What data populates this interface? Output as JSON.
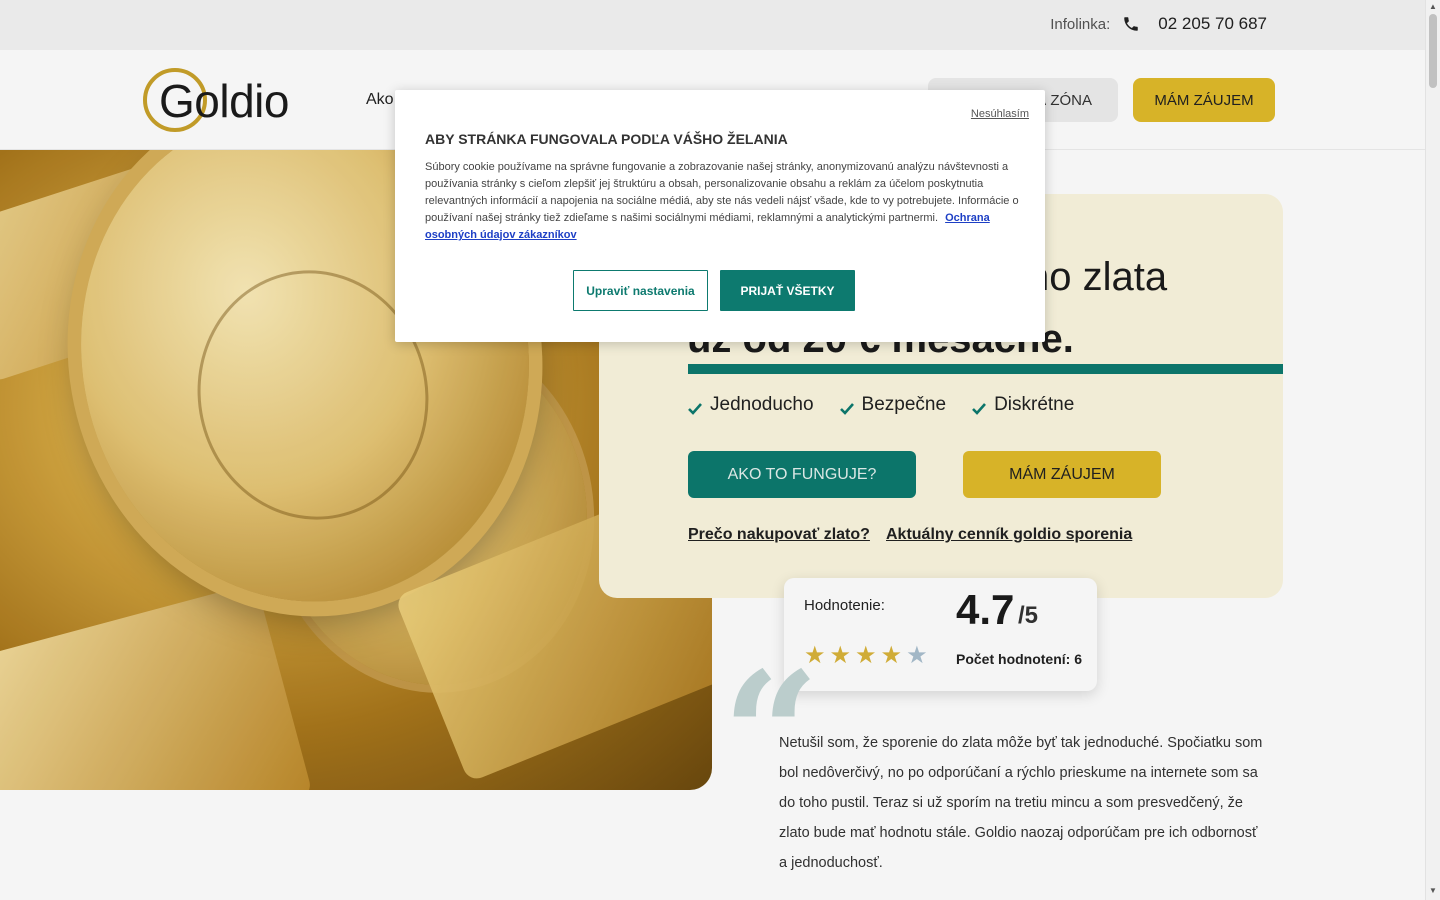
{
  "topbar": {
    "infolinka_label": "Infolinka:",
    "phone_number": "02 205 70 687"
  },
  "header": {
    "logo_text": "Goldio",
    "nav_partial": "Ako",
    "zona_partial": "Á ZÓNA",
    "cta_label": "MÁM ZÁUJEM"
  },
  "hero": {
    "title_line1": "no zlata",
    "title_line2": "už od 20 € mesačne.",
    "features": [
      {
        "label": "Jednoducho"
      },
      {
        "label": "Bezpečne"
      },
      {
        "label": "Diskrétne"
      }
    ],
    "how_button": "AKO TO FUNGUJE?",
    "interest_button": "MÁM ZÁUJEM",
    "link_why": "Prečo nakupovať zlato?",
    "link_pricelist": "Aktuálny cenník goldio sporenia"
  },
  "rating": {
    "label": "Hodnotenie:",
    "value": "4.7",
    "max": "/5",
    "stars_filled": 4,
    "stars_total": 5,
    "count_label": "Počet hodnotení: 6"
  },
  "testimonial": {
    "quote_mark": "“",
    "text": "Netušil som, že sporenie do zlata môže byť tak jednoduché. Spočiatku som bol nedôverčivý, no po odporúčaní a rýchlo prieskume na internete som sa do toho pustil. Teraz si už sporím na tretiu mincu a som presvedčený, že zlato bude mať hodnotu stále. Goldio naozaj odporúčam pre ich odbornosť a jednoduchosť."
  },
  "cookie_dialog": {
    "decline_label": "Nesúhlasím",
    "title": "ABY STRÁNKA FUNGOVALA PODĽA VÁŠHO ŽELANIA",
    "body": "Súbory cookie používame na správne fungovanie a zobrazovanie našej stránky, anonymizovanú analýzu návštevnosti a používania stránky s cieľom zlepšiť jej štruktúru a obsah, personalizovanie obsahu a reklám za účelom poskytnutia relevantných informácií a napojenia na sociálne médiá, aby ste nás vedeli nájsť všade, kde to vy potrebujete. Informácie o používaní našej stránky tiež zdieľame s našimi sociálnymi médiami, reklamnými a analytickými partnermi.",
    "privacy_link": "Ochrana osobných údajov zákazníkov",
    "settings_button": "Upraviť nastavenia",
    "accept_button": "PRIJAŤ VŠETKY"
  },
  "colors": {
    "teal": "#0d7a6f",
    "gold": "#e0bb2a",
    "panel_bg": "#fbf6df"
  }
}
